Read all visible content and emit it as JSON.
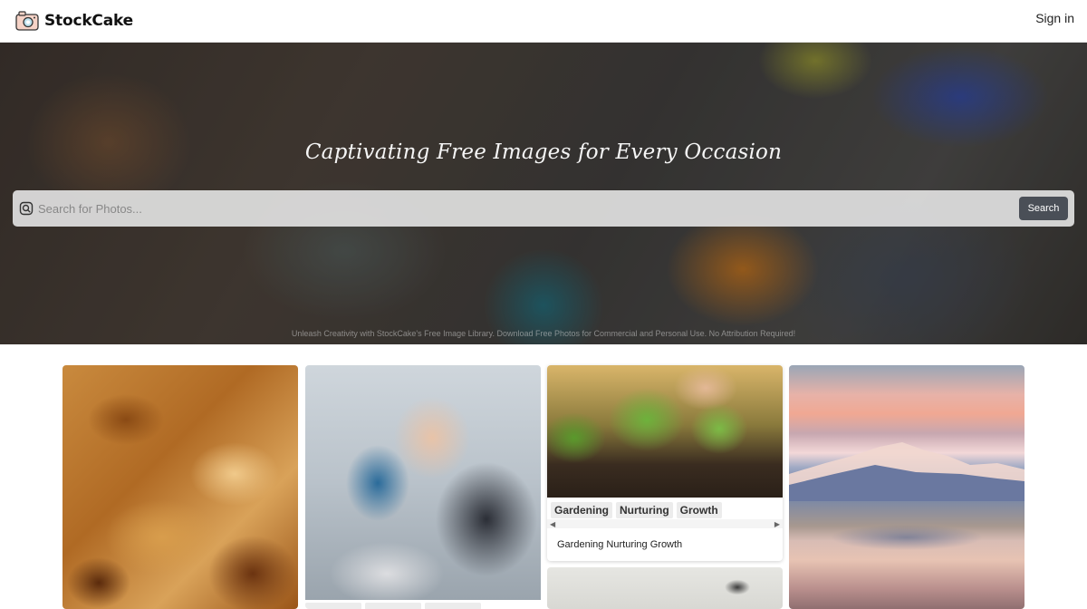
{
  "header": {
    "brand": "StockCake",
    "signin_label": "Sign in"
  },
  "hero": {
    "title": "Captivating Free Images for Every Occasion",
    "search_placeholder": "Search for Photos...",
    "search_button_label": "Search",
    "subtitle": "Unleash Creativity with StockCake's Free Image Library. Download Free Photos for Commercial and Personal Use. No Attribution Required!"
  },
  "gallery": {
    "garden_card": {
      "tags": [
        "Gardening",
        "Nurturing",
        "Growth"
      ],
      "caption": "Gardening Nurturing Growth"
    }
  },
  "colors": {
    "search_button": "#4a4f57",
    "tag_bg": "#ececec"
  }
}
